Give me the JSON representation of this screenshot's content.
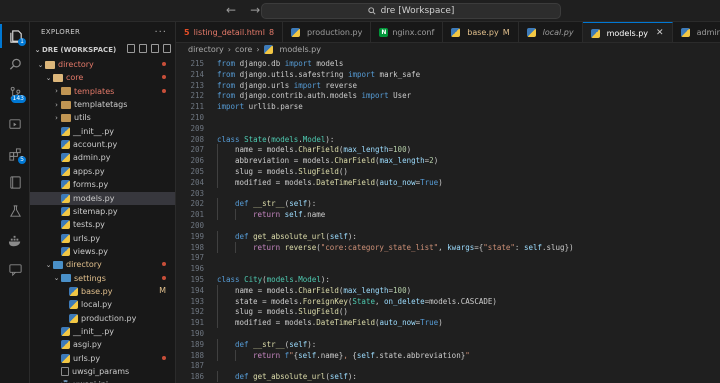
{
  "titlebar": {
    "back": "←",
    "forward": "→",
    "search_text": "dre [Workspace]"
  },
  "activity": {
    "explorer_badge": "1",
    "scm_badge": "143",
    "extensions_badge": "5"
  },
  "sidebar": {
    "header": "EXPLORER",
    "workspace": "DRE (WORKSPACE)",
    "tree": [
      {
        "label": "directory",
        "indent": 1,
        "type": "folder-open",
        "chev": "⌄",
        "git": "dot",
        "cls": "red"
      },
      {
        "label": "core",
        "indent": 2,
        "type": "folder-open",
        "chev": "⌄",
        "git": "dot",
        "cls": "red"
      },
      {
        "label": "templates",
        "indent": 3,
        "type": "folder",
        "chev": "›",
        "git": "dot",
        "cls": "red"
      },
      {
        "label": "templatetags",
        "indent": 3,
        "type": "folder",
        "chev": "›",
        "git": "",
        "cls": ""
      },
      {
        "label": "utils",
        "indent": 3,
        "type": "folder",
        "chev": "›",
        "git": "",
        "cls": ""
      },
      {
        "label": "__init__.py",
        "indent": 3,
        "type": "py",
        "chev": "",
        "git": "",
        "cls": ""
      },
      {
        "label": "account.py",
        "indent": 3,
        "type": "py",
        "chev": "",
        "git": "",
        "cls": ""
      },
      {
        "label": "admin.py",
        "indent": 3,
        "type": "py",
        "chev": "",
        "git": "",
        "cls": ""
      },
      {
        "label": "apps.py",
        "indent": 3,
        "type": "py",
        "chev": "",
        "git": "",
        "cls": ""
      },
      {
        "label": "forms.py",
        "indent": 3,
        "type": "py",
        "chev": "",
        "git": "",
        "cls": ""
      },
      {
        "label": "models.py",
        "indent": 3,
        "type": "py",
        "chev": "",
        "git": "",
        "cls": "",
        "selected": true
      },
      {
        "label": "sitemap.py",
        "indent": 3,
        "type": "py",
        "chev": "",
        "git": "",
        "cls": ""
      },
      {
        "label": "tests.py",
        "indent": 3,
        "type": "py",
        "chev": "",
        "git": "",
        "cls": ""
      },
      {
        "label": "urls.py",
        "indent": 3,
        "type": "py",
        "chev": "",
        "git": "",
        "cls": ""
      },
      {
        "label": "views.py",
        "indent": 3,
        "type": "py",
        "chev": "",
        "git": "",
        "cls": ""
      },
      {
        "label": "directory",
        "indent": 2,
        "type": "folder-blue",
        "chev": "⌄",
        "git": "dot",
        "cls": "mod"
      },
      {
        "label": "settings",
        "indent": 3,
        "type": "folder-blue",
        "chev": "⌄",
        "git": "dot",
        "cls": "mod"
      },
      {
        "label": "base.py",
        "indent": 4,
        "type": "py",
        "chev": "",
        "git": "M",
        "cls": "mod"
      },
      {
        "label": "local.py",
        "indent": 4,
        "type": "py",
        "chev": "",
        "git": "",
        "cls": ""
      },
      {
        "label": "production.py",
        "indent": 4,
        "type": "py",
        "chev": "",
        "git": "",
        "cls": ""
      },
      {
        "label": "__init__.py",
        "indent": 3,
        "type": "py",
        "chev": "",
        "git": "",
        "cls": ""
      },
      {
        "label": "asgi.py",
        "indent": 3,
        "type": "py",
        "chev": "",
        "git": "",
        "cls": ""
      },
      {
        "label": "urls.py",
        "indent": 3,
        "type": "py",
        "chev": "",
        "git": "dot",
        "cls": ""
      },
      {
        "label": "uwsgi_params",
        "indent": 3,
        "type": "file",
        "chev": "",
        "git": "",
        "cls": ""
      },
      {
        "label": "uwsgi.ini",
        "indent": 3,
        "type": "gear",
        "chev": "",
        "git": "",
        "cls": ""
      }
    ]
  },
  "tabs": [
    {
      "label": "listing_detail.html",
      "icon": "html",
      "suffix": "8",
      "active": false,
      "italic": false
    },
    {
      "label": "production.py",
      "icon": "py",
      "suffix": "",
      "active": false,
      "italic": false
    },
    {
      "label": "nginx.conf",
      "icon": "nginx",
      "suffix": "",
      "active": false,
      "italic": false
    },
    {
      "label": "base.py",
      "icon": "py",
      "suffix": "M",
      "active": false,
      "italic": false
    },
    {
      "label": "local.py",
      "icon": "py",
      "suffix": "",
      "active": false,
      "italic": true
    },
    {
      "label": "models.py",
      "icon": "py",
      "suffix": "",
      "active": true,
      "italic": false
    },
    {
      "label": "admin.py",
      "icon": "py",
      "suffix": "",
      "active": false,
      "italic": false
    }
  ],
  "breadcrumb": {
    "parts": [
      "directory",
      "core",
      "models.py"
    ],
    "sep": "›"
  },
  "editor": {
    "lines": [
      {
        "n": "215",
        "indent": 0,
        "tokens": [
          [
            "k",
            "from"
          ],
          [
            "t",
            " django.db "
          ],
          [
            "k",
            "import"
          ],
          [
            "t",
            " models"
          ]
        ]
      },
      {
        "n": "214",
        "indent": 0,
        "tokens": [
          [
            "k",
            "from"
          ],
          [
            "t",
            " django.utils.safestring "
          ],
          [
            "k",
            "import"
          ],
          [
            "t",
            " mark_safe"
          ]
        ]
      },
      {
        "n": "213",
        "indent": 0,
        "tokens": [
          [
            "k",
            "from"
          ],
          [
            "t",
            " django.urls "
          ],
          [
            "k",
            "import"
          ],
          [
            "t",
            " reverse"
          ]
        ]
      },
      {
        "n": "212",
        "indent": 0,
        "tokens": [
          [
            "k",
            "from"
          ],
          [
            "t",
            " django.contrib.auth.models "
          ],
          [
            "k",
            "import"
          ],
          [
            "t",
            " User"
          ]
        ]
      },
      {
        "n": "211",
        "indent": 0,
        "tokens": [
          [
            "k",
            "import"
          ],
          [
            "t",
            " urllib.parse"
          ]
        ]
      },
      {
        "n": "210",
        "indent": 0,
        "tokens": []
      },
      {
        "n": "209",
        "indent": 0,
        "tokens": []
      },
      {
        "n": "208",
        "indent": 0,
        "tokens": [
          [
            "k",
            "class "
          ],
          [
            "cls",
            "State"
          ],
          [
            "t",
            "("
          ],
          [
            "cls",
            "models"
          ],
          [
            "t",
            "."
          ],
          [
            "cls",
            "Model"
          ],
          [
            "t",
            "):"
          ]
        ]
      },
      {
        "n": "207",
        "indent": 1,
        "tokens": [
          [
            "t",
            "name = models."
          ],
          [
            "fn",
            "CharField"
          ],
          [
            "t",
            "("
          ],
          [
            "pr",
            "max_length"
          ],
          [
            "t",
            "="
          ],
          [
            "num",
            "100"
          ],
          [
            "t",
            ")"
          ]
        ]
      },
      {
        "n": "206",
        "indent": 1,
        "tokens": [
          [
            "t",
            "abbreviation = models."
          ],
          [
            "fn",
            "CharField"
          ],
          [
            "t",
            "("
          ],
          [
            "pr",
            "max_length"
          ],
          [
            "t",
            "="
          ],
          [
            "num",
            "2"
          ],
          [
            "t",
            ")"
          ]
        ]
      },
      {
        "n": "205",
        "indent": 1,
        "tokens": [
          [
            "t",
            "slug = models."
          ],
          [
            "fn",
            "SlugField"
          ],
          [
            "t",
            "()"
          ]
        ]
      },
      {
        "n": "204",
        "indent": 1,
        "tokens": [
          [
            "t",
            "modified = models."
          ],
          [
            "fn",
            "DateTimeField"
          ],
          [
            "t",
            "("
          ],
          [
            "pr",
            "auto_now"
          ],
          [
            "t",
            "="
          ],
          [
            "k",
            "True"
          ],
          [
            "t",
            ")"
          ]
        ]
      },
      {
        "n": "203",
        "indent": 0,
        "tokens": []
      },
      {
        "n": "202",
        "indent": 1,
        "tokens": [
          [
            "k",
            "def "
          ],
          [
            "fn",
            "__str__"
          ],
          [
            "t",
            "("
          ],
          [
            "var",
            "self"
          ],
          [
            "t",
            "):"
          ]
        ]
      },
      {
        "n": "201",
        "indent": 2,
        "tokens": [
          [
            "kc",
            "return "
          ],
          [
            "var",
            "self"
          ],
          [
            "t",
            ".name"
          ]
        ]
      },
      {
        "n": "200",
        "indent": 0,
        "tokens": []
      },
      {
        "n": "199",
        "indent": 1,
        "tokens": [
          [
            "k",
            "def "
          ],
          [
            "fn",
            "get_absolute_url"
          ],
          [
            "t",
            "("
          ],
          [
            "var",
            "self"
          ],
          [
            "t",
            "):"
          ]
        ]
      },
      {
        "n": "198",
        "indent": 2,
        "tokens": [
          [
            "kc",
            "return "
          ],
          [
            "fn",
            "reverse"
          ],
          [
            "t",
            "("
          ],
          [
            "str",
            "\"core:category_state_list\""
          ],
          [
            "t",
            ", "
          ],
          [
            "pr",
            "kwargs"
          ],
          [
            "t",
            "={"
          ],
          [
            "str",
            "\"state\""
          ],
          [
            "t",
            ": "
          ],
          [
            "var",
            "self"
          ],
          [
            "t",
            ".slug})"
          ]
        ]
      },
      {
        "n": "197",
        "indent": 0,
        "tokens": []
      },
      {
        "n": "196",
        "indent": 0,
        "tokens": []
      },
      {
        "n": "195",
        "indent": 0,
        "tokens": [
          [
            "k",
            "class "
          ],
          [
            "cls",
            "City"
          ],
          [
            "t",
            "("
          ],
          [
            "cls",
            "models"
          ],
          [
            "t",
            "."
          ],
          [
            "cls",
            "Model"
          ],
          [
            "t",
            "):"
          ]
        ]
      },
      {
        "n": "194",
        "indent": 1,
        "tokens": [
          [
            "t",
            "name = models."
          ],
          [
            "fn",
            "CharField"
          ],
          [
            "t",
            "("
          ],
          [
            "pr",
            "max_length"
          ],
          [
            "t",
            "="
          ],
          [
            "num",
            "100"
          ],
          [
            "t",
            ")"
          ]
        ]
      },
      {
        "n": "193",
        "indent": 1,
        "tokens": [
          [
            "t",
            "state = models."
          ],
          [
            "fn",
            "ForeignKey"
          ],
          [
            "t",
            "("
          ],
          [
            "cls",
            "State"
          ],
          [
            "t",
            ", "
          ],
          [
            "pr",
            "on_delete"
          ],
          [
            "t",
            "=models.CASCADE)"
          ]
        ]
      },
      {
        "n": "192",
        "indent": 1,
        "tokens": [
          [
            "t",
            "slug = models."
          ],
          [
            "fn",
            "SlugField"
          ],
          [
            "t",
            "()"
          ]
        ]
      },
      {
        "n": "191",
        "indent": 1,
        "tokens": [
          [
            "t",
            "modified = models."
          ],
          [
            "fn",
            "DateTimeField"
          ],
          [
            "t",
            "("
          ],
          [
            "pr",
            "auto_now"
          ],
          [
            "t",
            "="
          ],
          [
            "k",
            "True"
          ],
          [
            "t",
            ")"
          ]
        ]
      },
      {
        "n": "190",
        "indent": 0,
        "tokens": []
      },
      {
        "n": "189",
        "indent": 1,
        "tokens": [
          [
            "k",
            "def "
          ],
          [
            "fn",
            "__str__"
          ],
          [
            "t",
            "("
          ],
          [
            "var",
            "self"
          ],
          [
            "t",
            "):"
          ]
        ]
      },
      {
        "n": "188",
        "indent": 2,
        "tokens": [
          [
            "kc",
            "return "
          ],
          [
            "k",
            "f"
          ],
          [
            "str",
            "\""
          ],
          [
            "t",
            "{"
          ],
          [
            "var",
            "self"
          ],
          [
            "t",
            ".name}"
          ],
          [
            "str",
            ", "
          ],
          [
            "t",
            "{"
          ],
          [
            "var",
            "self"
          ],
          [
            "t",
            ".state.abbreviation}"
          ],
          [
            "str",
            "\""
          ]
        ]
      },
      {
        "n": "187",
        "indent": 0,
        "tokens": []
      },
      {
        "n": "186",
        "indent": 1,
        "tokens": [
          [
            "k",
            "def "
          ],
          [
            "fn",
            "get_absolute_url"
          ],
          [
            "t",
            "("
          ],
          [
            "var",
            "self"
          ],
          [
            "t",
            "):"
          ]
        ]
      }
    ]
  }
}
